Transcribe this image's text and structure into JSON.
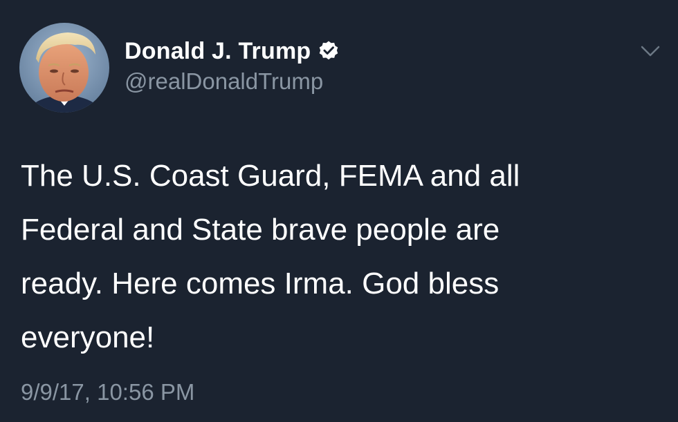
{
  "tweet": {
    "author": {
      "display_name": "Donald J. Trump",
      "handle": "@realDonaldTrump",
      "verified": true,
      "avatar_icon": "profile-photo"
    },
    "text": "The U.S. Coast Guard, FEMA and all\nFederal and State brave people are\nready. Here comes Irma. God bless\neveryone!",
    "timestamp": "9/9/17, 10:56 PM",
    "menu_icon": "chevron-down-icon"
  },
  "colors": {
    "background": "#1b2330",
    "primary_text": "#ffffff",
    "secondary_text": "#8a96a3",
    "verified_badge": "#ffffff"
  }
}
